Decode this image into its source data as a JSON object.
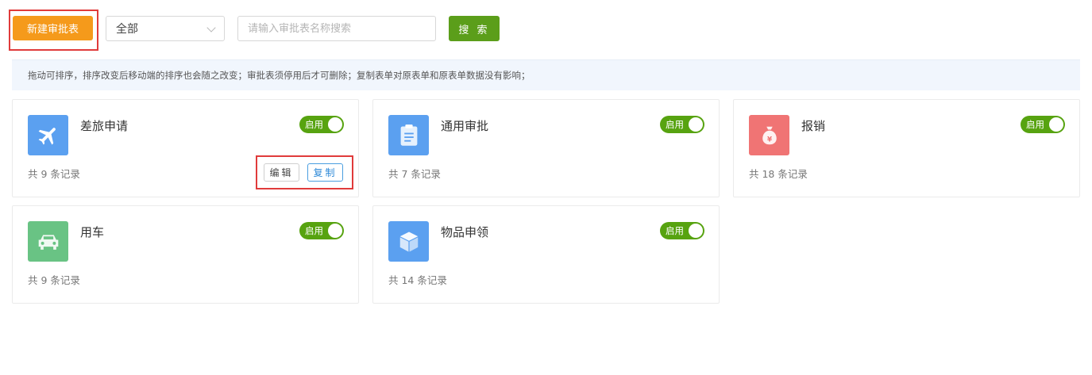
{
  "toolbar": {
    "new_button_label": "新建审批表",
    "filter_selected": "全部",
    "search_placeholder": "请输入审批表名称搜索",
    "search_button_label": "搜 索"
  },
  "notice": "拖动可排序，排序改变后移动端的排序也会随之改变；审批表须停用后才可删除；复制表单对原表单和原表单数据没有影响；",
  "colors": {
    "primary_orange": "#f59a1b",
    "search_green": "#5b9e1a",
    "toggle_green": "#57a310",
    "highlight_red": "#e03b3b",
    "link_blue": "#2f8ad8"
  },
  "cards": [
    {
      "title": "差旅申请",
      "count_text": "共 9 条记录",
      "toggle_label": "启用",
      "enabled": true,
      "icon": "airplane-icon",
      "icon_color": "#5ba0f0",
      "edit_label": "编辑",
      "copy_label": "复制"
    },
    {
      "title": "通用审批",
      "count_text": "共 7 条记录",
      "toggle_label": "启用",
      "enabled": true,
      "icon": "clipboard-icon",
      "icon_color": "#5ba0f0"
    },
    {
      "title": "报销",
      "count_text": "共 18 条记录",
      "toggle_label": "启用",
      "enabled": true,
      "icon": "money-bag-icon",
      "icon_color": "#f07474"
    },
    {
      "title": "用车",
      "count_text": "共 9 条记录",
      "toggle_label": "启用",
      "enabled": true,
      "icon": "car-icon",
      "icon_color": "#69c384"
    },
    {
      "title": "物品申领",
      "count_text": "共 14 条记录",
      "toggle_label": "启用",
      "enabled": true,
      "icon": "box-icon",
      "icon_color": "#5ba0f0"
    }
  ]
}
